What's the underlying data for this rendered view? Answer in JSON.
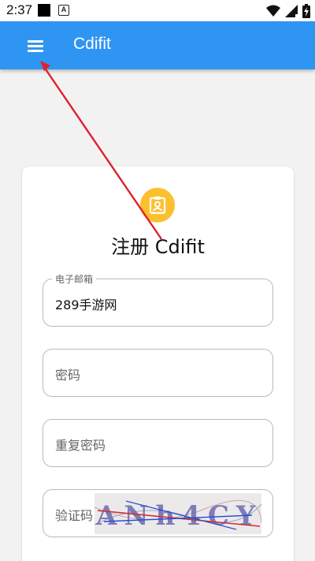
{
  "status_bar": {
    "time": "2:37",
    "notification_badge": "A",
    "icons": [
      "black-square-icon",
      "a-badge-icon",
      "wifi-icon",
      "cellular-icon",
      "battery-icon"
    ]
  },
  "app_bar": {
    "title": "Cdifit",
    "menu_icon": "hamburger-menu-icon",
    "color": "#2f95f3"
  },
  "form": {
    "badge_icon": "contact-card-icon",
    "badge_color": "#fbc02d",
    "title": "注册 Cdifit",
    "email": {
      "label": "电子邮箱",
      "value": "289手游网"
    },
    "password": {
      "placeholder": "密码"
    },
    "repeat_password": {
      "placeholder": "重复密码"
    },
    "captcha": {
      "placeholder": "验证码",
      "image_text": "ANh4CY"
    }
  },
  "annotation": {
    "color": "#e0202a",
    "description": "red arrow pointing to menu button"
  }
}
